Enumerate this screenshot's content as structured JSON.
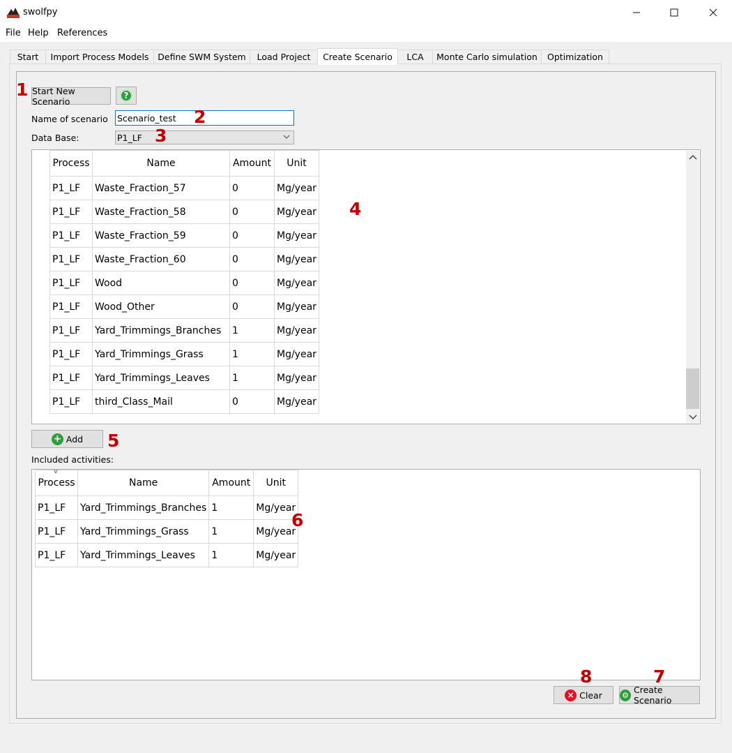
{
  "window": {
    "title": "swolfpy"
  },
  "menu": [
    "File",
    "Help",
    "References"
  ],
  "tabs": [
    "Start",
    "Import Process Models",
    "Define SWM System",
    "Load Project",
    "Create Scenario",
    "LCA",
    "Monte Carlo simulation",
    "Optimization"
  ],
  "active_tab": "Create Scenario",
  "controls": {
    "start_new_label": "Start New Scenario",
    "name_label": "Name of scenario",
    "name_value": "Scenario_test",
    "database_label": "Data Base:",
    "database_value": "P1_LF",
    "add_label": "Add",
    "included_label": "Included activities:",
    "clear_label": "Clear",
    "create_label": "Create Scenario"
  },
  "markers": [
    "1",
    "2",
    "3",
    "4",
    "5",
    "6",
    "7",
    "8"
  ],
  "table_headers": [
    "Process",
    "Name",
    "Amount",
    "Unit"
  ],
  "activities": [
    [
      "P1_LF",
      "Waste_Fraction_57",
      "0",
      "Mg/year"
    ],
    [
      "P1_LF",
      "Waste_Fraction_58",
      "0",
      "Mg/year"
    ],
    [
      "P1_LF",
      "Waste_Fraction_59",
      "0",
      "Mg/year"
    ],
    [
      "P1_LF",
      "Waste_Fraction_60",
      "0",
      "Mg/year"
    ],
    [
      "P1_LF",
      "Wood",
      "0",
      "Mg/year"
    ],
    [
      "P1_LF",
      "Wood_Other",
      "0",
      "Mg/year"
    ],
    [
      "P1_LF",
      "Yard_Trimmings_Branches",
      "1",
      "Mg/year"
    ],
    [
      "P1_LF",
      "Yard_Trimmings_Grass",
      "1",
      "Mg/year"
    ],
    [
      "P1_LF",
      "Yard_Trimmings_Leaves",
      "1",
      "Mg/year"
    ],
    [
      "P1_LF",
      "third_Class_Mail",
      "0",
      "Mg/year"
    ]
  ],
  "included": [
    [
      "P1_LF",
      "Yard_Trimmings_Branches",
      "1",
      "Mg/year"
    ],
    [
      "P1_LF",
      "Yard_Trimmings_Grass",
      "1",
      "Mg/year"
    ],
    [
      "P1_LF",
      "Yard_Trimmings_Leaves",
      "1",
      "Mg/year"
    ]
  ],
  "colors": {
    "marker": "#c00000",
    "accent": "#0078d7",
    "green_icon": "#2e9e3a",
    "red_icon": "#e81123"
  }
}
